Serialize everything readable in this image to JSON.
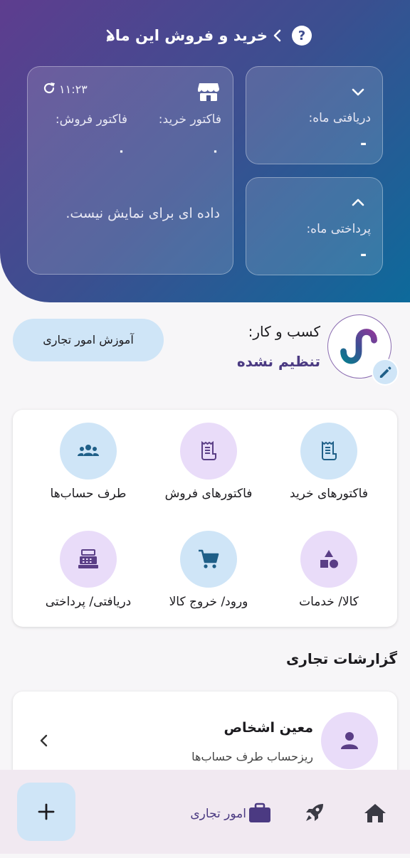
{
  "header": {
    "title": "خرید و فروش این ماه"
  },
  "summary": {
    "time": "۱۱:۲۳",
    "buy_label": "فاکتور خرید:",
    "sell_label": "فاکتور فروش:",
    "buy_value": "۰",
    "sell_value": "۰",
    "empty_message": "داده ای برای نمایش نیست."
  },
  "receive": {
    "label": "دریافتی ماه:",
    "value": "-"
  },
  "payment": {
    "label": "پرداختی ماه:",
    "value": "-"
  },
  "business": {
    "label": "کسب و کار:",
    "value": "تنظیم نشده",
    "training_button": "آموزش امور تجاری"
  },
  "shortcuts": [
    {
      "label": "فاکتورهای خرید",
      "icon": "receipt-icon"
    },
    {
      "label": "فاکتورهای فروش",
      "icon": "receipt-icon"
    },
    {
      "label": "طرف حساب‌ها",
      "icon": "group-icon"
    },
    {
      "label": "کالا/ خدمات",
      "icon": "shapes-icon"
    },
    {
      "label": "ورود/ خروج کالا",
      "icon": "cart-icon"
    },
    {
      "label": "دریافتی/ پرداختی",
      "icon": "cash-register-icon"
    }
  ],
  "reports": {
    "title": "گزارشات تجاری",
    "items": [
      {
        "title": "معین اشخاص",
        "subtitle": "ریزحساب طرف حساب‌ها"
      }
    ]
  },
  "bottom_nav": {
    "business_label": "امور تجاری"
  },
  "colors": {
    "accent_purple": "#4b3a82",
    "light_blue": "#cfe5f7",
    "light_purple": "#e9dcf9",
    "icon_blue": "#1f5f88",
    "icon_purple": "#5a3e86"
  }
}
